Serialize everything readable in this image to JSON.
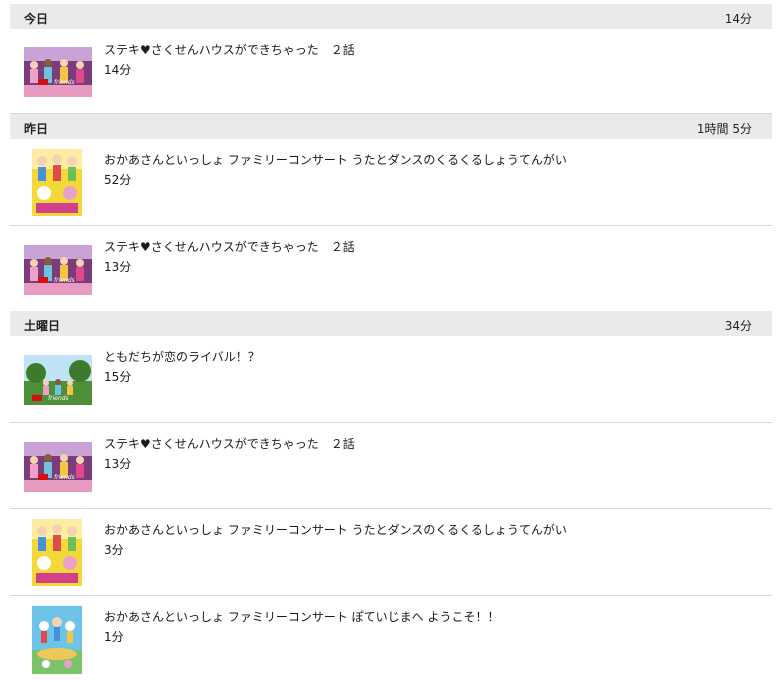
{
  "groups": [
    {
      "day": "今日",
      "total": "14分",
      "items": [
        {
          "title": "ステキ♥さくせんハウスができちゃった　２話",
          "duration": "14分",
          "thumb": "friends-house-thumbnail"
        }
      ]
    },
    {
      "day": "昨日",
      "total": "1時間 5分",
      "items": [
        {
          "title": "おかあさんといっしょ ファミリーコンサート うたとダンスのくるくるしょうてんがい",
          "duration": "52分",
          "thumb": "family-concert-thumbnail"
        },
        {
          "title": "ステキ♥さくせんハウスができちゃった　２話",
          "duration": "13分",
          "thumb": "friends-house-thumbnail"
        }
      ]
    },
    {
      "day": "土曜日",
      "total": "34分",
      "items": [
        {
          "title": "ともだちが恋のライバル！？",
          "duration": "15分",
          "thumb": "friends-park-thumbnail"
        },
        {
          "title": "ステキ♥さくせんハウスができちゃった　２話",
          "duration": "13分",
          "thumb": "friends-house-thumbnail"
        },
        {
          "title": "おかあさんといっしょ ファミリーコンサート うたとダンスのくるくるしょうてんがい",
          "duration": "3分",
          "thumb": "family-concert-thumbnail"
        },
        {
          "title": "おかあさんといっしょ ファミリーコンサート ぽていじまへ ようこそ！！",
          "duration": "1分",
          "thumb": "potei-island-thumbnail"
        }
      ]
    }
  ],
  "colors": {
    "header_bg": "#e8eaeb",
    "divider": "#d8d8d8",
    "friends_purple": "#7b3d7a",
    "friends_pink": "#e0478c",
    "lego_red": "#d01012",
    "park_green": "#4f8f3a",
    "concert_yellow": "#f3d83a",
    "potei_sky": "#6cc4e8"
  }
}
